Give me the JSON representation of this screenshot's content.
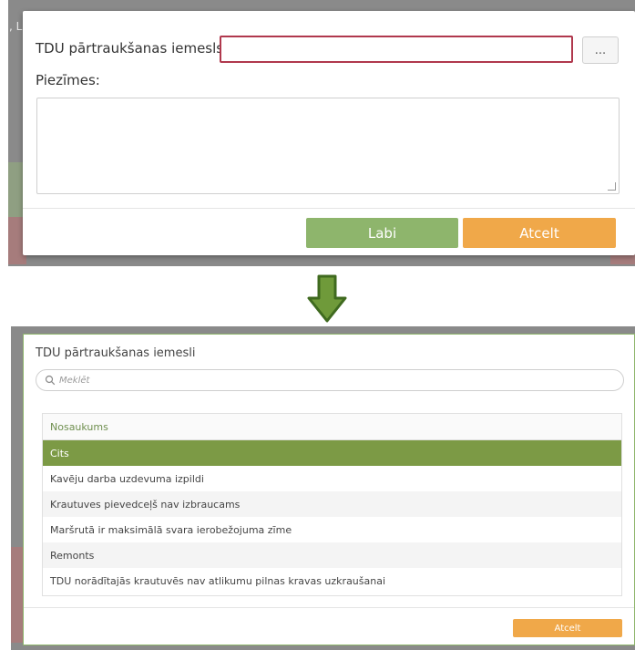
{
  "top_dialog": {
    "background_text": ", L",
    "reason_label": "TDU pārtraukšanas iemesls:",
    "reason_value": "",
    "browse_button": "...",
    "notes_label": "Piezīmes:",
    "notes_value": "",
    "ok_button": "Labi",
    "cancel_button": "Atcelt"
  },
  "arrow_icon": "arrow-down-icon",
  "list_dialog": {
    "title": "TDU pārtraukšanas iemesli",
    "search_placeholder": "Meklēt",
    "column_header": "Nosaukums",
    "rows": [
      "Cits",
      "Kavēju darba uzdevuma izpildi",
      "Krautuves pievedceļš nav izbraucams",
      "Maršrutā ir maksimālā svara ierobežojuma zīme",
      "Remonts",
      "TDU norādītajās krautuvēs nav atlikumu pilnas kravas uzkraušanai"
    ],
    "selected_row": "Cits",
    "cancel_button": "Atcelt"
  },
  "colors": {
    "accent_green": "#8eb56c",
    "selected_green": "#7c9a45",
    "cancel_orange": "#f0a849",
    "invalid_border": "#b0384d"
  }
}
